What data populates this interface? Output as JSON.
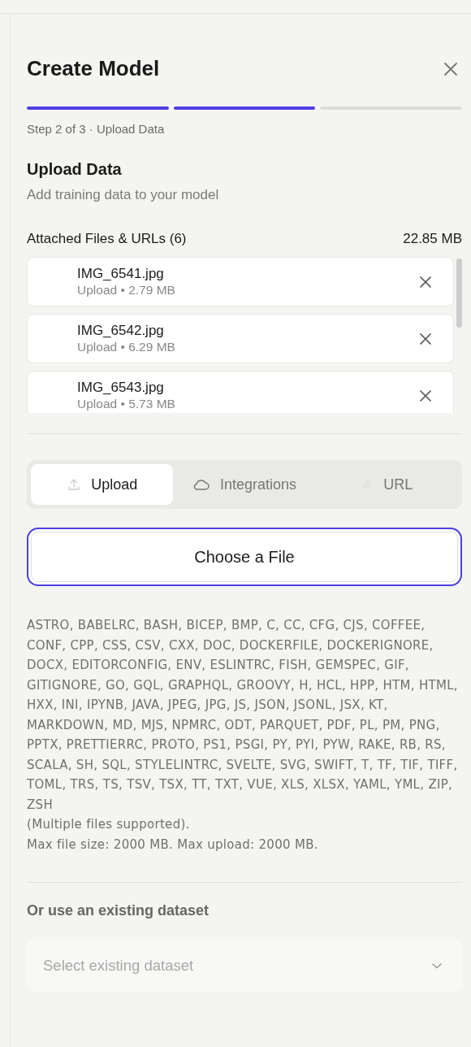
{
  "dialog": {
    "title": "Create Model"
  },
  "steps": [
    {
      "done": true
    },
    {
      "done": true
    },
    {
      "done": false
    }
  ],
  "step_label": "Step 2 of 3 · Upload Data",
  "section": {
    "title": "Upload Data",
    "subtitle": "Add training data to your model"
  },
  "attachments": {
    "label": "Attached Files & URLs (6)",
    "total": "22.85 MB",
    "files": [
      {
        "name": "IMG_6541.jpg",
        "meta": "Upload • 2.79 MB"
      },
      {
        "name": "IMG_6542.jpg",
        "meta": "Upload • 6.29 MB"
      },
      {
        "name": "IMG_6543.jpg",
        "meta": "Upload • 5.73 MB"
      }
    ]
  },
  "tabs": [
    {
      "label": "Upload",
      "kind": "upload",
      "selected": true
    },
    {
      "label": "Integrations",
      "kind": "integrations",
      "selected": false
    },
    {
      "label": "URL",
      "kind": "url",
      "selected": false
    }
  ],
  "choose_button": "Choose a File",
  "formats": "ASTRO, BABELRC, BASH, BICEP, BMP, C, CC, CFG, CJS, COFFEE, CONF, CPP, CSS, CSV, CXX, DOC, DOCKERFILE, DOCKERIGNORE, DOCX, EDITORCONFIG, ENV, ESLINTRC, FISH, GEMSPEC, GIF, GITIGNORE, GO, GQL, GRAPHQL, GROOVY, H, HCL, HPP, HTM, HTML, HXX, INI, IPYNB, JAVA, JPEG, JPG, JS, JSON, JSONL, JSX, KT, MARKDOWN, MD, MJS, NPMRC, ODT, PARQUET, PDF, PL, PM, PNG, PPTX, PRETTIERRC, PROTO, PS1, PSGI, PY, PYI, PYW, RAKE, RB, RS, SCALA, SH, SQL, STYLELINTRC, SVELTE, SVG, SWIFT, T, TF, TIF, TIFF, TOML, TRS, TS, TSV, TSX, TT, TXT, VUE, XLS, XLSX, YAML, YML, ZIP, ZSH",
  "multiple_note": "(Multiple files supported).",
  "limits": "Max file size: 2000 MB. Max upload: 2000 MB.",
  "existing": {
    "label": "Or use an existing dataset",
    "placeholder": "Select existing dataset"
  }
}
